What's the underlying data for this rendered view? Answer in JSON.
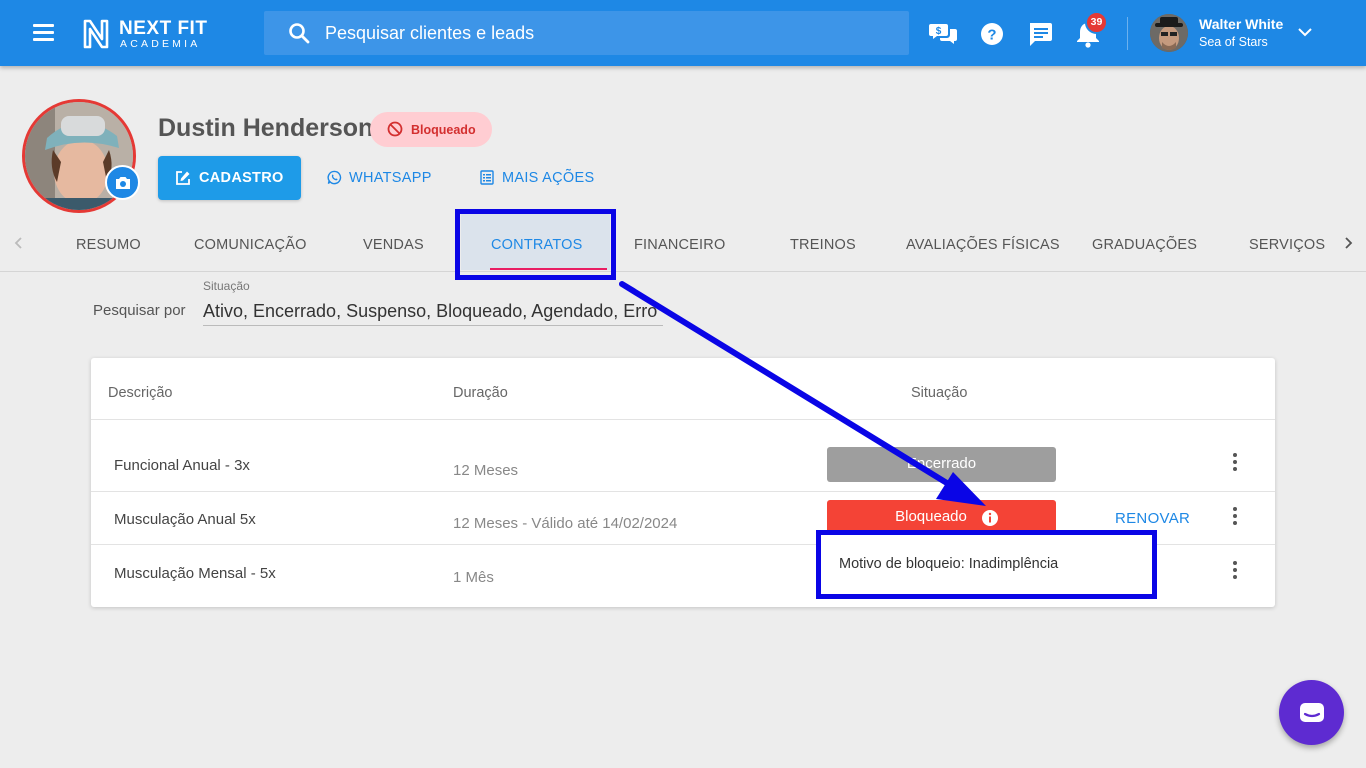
{
  "app": {
    "logo_line1": "NEXT FIT",
    "logo_line2": "ACADEMIA",
    "search_placeholder": "Pesquisar clientes e leads",
    "notification_count": "39",
    "user_name": "Walter White",
    "user_org": "Sea of Stars"
  },
  "profile": {
    "name": "Dustin Henderson",
    "status": "Bloqueado",
    "actions": {
      "cadastro": "CADASTRO",
      "whatsapp": "WHATSAPP",
      "mais_acoes": "MAIS AÇÕES"
    }
  },
  "tabs": [
    "RESUMO",
    "COMUNICAÇÃO",
    "VENDAS",
    "CONTRATOS",
    "FINANCEIRO",
    "TREINOS",
    "AVALIAÇÕES FÍSICAS",
    "GRADUAÇÕES",
    "SERVIÇOS"
  ],
  "active_tab": "CONTRATOS",
  "filter": {
    "label": "Pesquisar por",
    "field_label": "Situação",
    "value": "Ativo, Encerrado, Suspenso, Bloqueado, Agendado, Erro"
  },
  "table": {
    "headers": {
      "descricao": "Descrição",
      "duracao": "Duração",
      "situacao": "Situação"
    },
    "rows": [
      {
        "descricao": "Funcional Anual - 3x",
        "duracao": "12 Meses",
        "situacao": "Encerrado",
        "action": ""
      },
      {
        "descricao": "Musculação Anual 5x",
        "duracao": "12 Meses - Válido até 14/02/2024",
        "situacao": "Bloqueado",
        "action": "RENOVAR"
      },
      {
        "descricao": "Musculação Mensal - 5x",
        "duracao": "1 Mês",
        "situacao": "",
        "action": ""
      }
    ]
  },
  "tooltip": "Motivo de bloqueio: Inadimplência",
  "colors": {
    "primary": "#1e88e5",
    "blocked": "#f44336",
    "closed": "#9e9e9e",
    "annotation": "#0a05e6",
    "chat": "#5e2bd1"
  }
}
